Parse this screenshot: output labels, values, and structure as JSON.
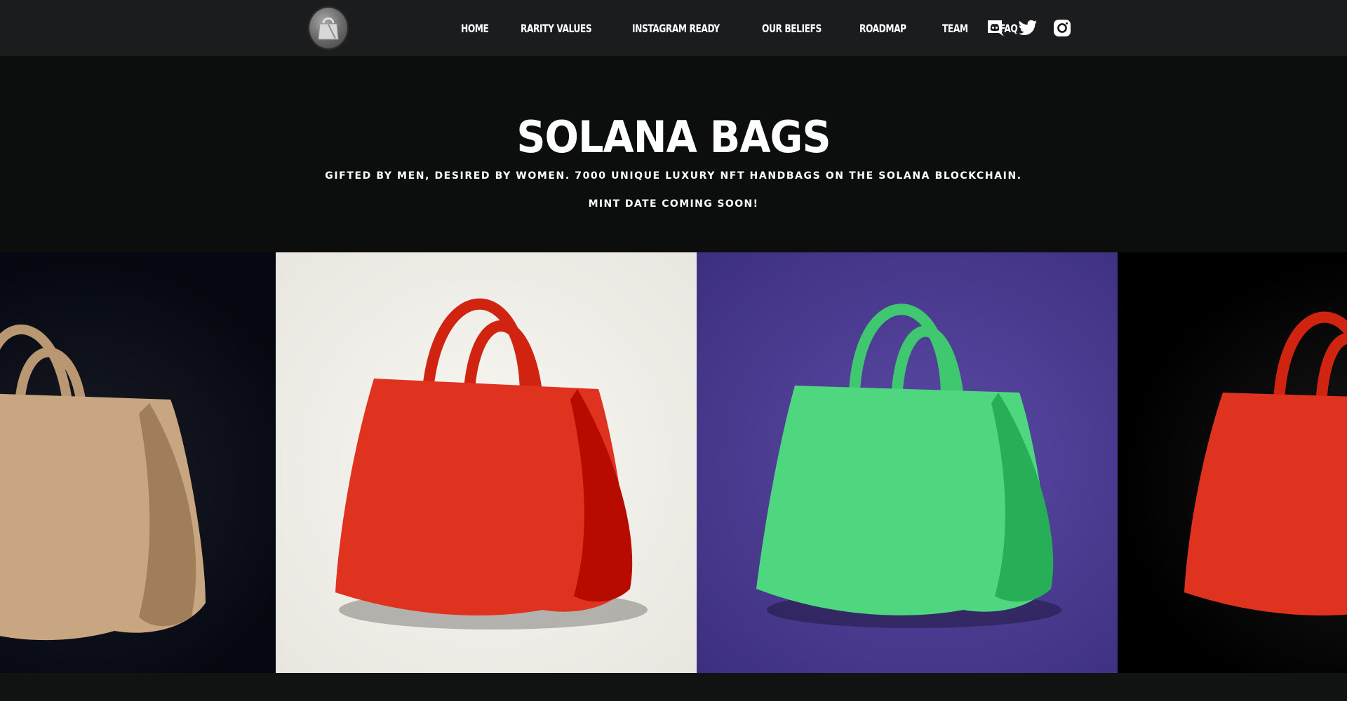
{
  "header": {
    "logo_icon": "handbag-logo",
    "nav": [
      {
        "label": "HOME"
      },
      {
        "label": "RARITY VALUES"
      },
      {
        "label": "INSTAGRAM READY"
      },
      {
        "label": "OUR BELIEFS"
      },
      {
        "label": "ROADMAP"
      },
      {
        "label": "TEAM"
      },
      {
        "label": "FAQ"
      }
    ],
    "social": [
      "discord-icon",
      "twitter-icon",
      "instagram-icon"
    ]
  },
  "hero": {
    "title": "SOLANA BAGS",
    "subtitle": "GIFTED BY MEN, DESIRED BY WOMEN. 7000 UNIQUE LUXURY NFT HANDBAGS ON THE SOLANA BLOCKCHAIN.",
    "mint": "MINT DATE COMING SOON!"
  },
  "gallery": {
    "tiles": [
      {
        "bag_color": "#c9a682",
        "background": "#060912"
      },
      {
        "bag_color": "#e0331f",
        "background": "#f3f1ea"
      },
      {
        "bag_color": "#4ed77e",
        "background": "#48398c"
      },
      {
        "bag_color": "#e0331f",
        "background": "#050505"
      }
    ]
  }
}
